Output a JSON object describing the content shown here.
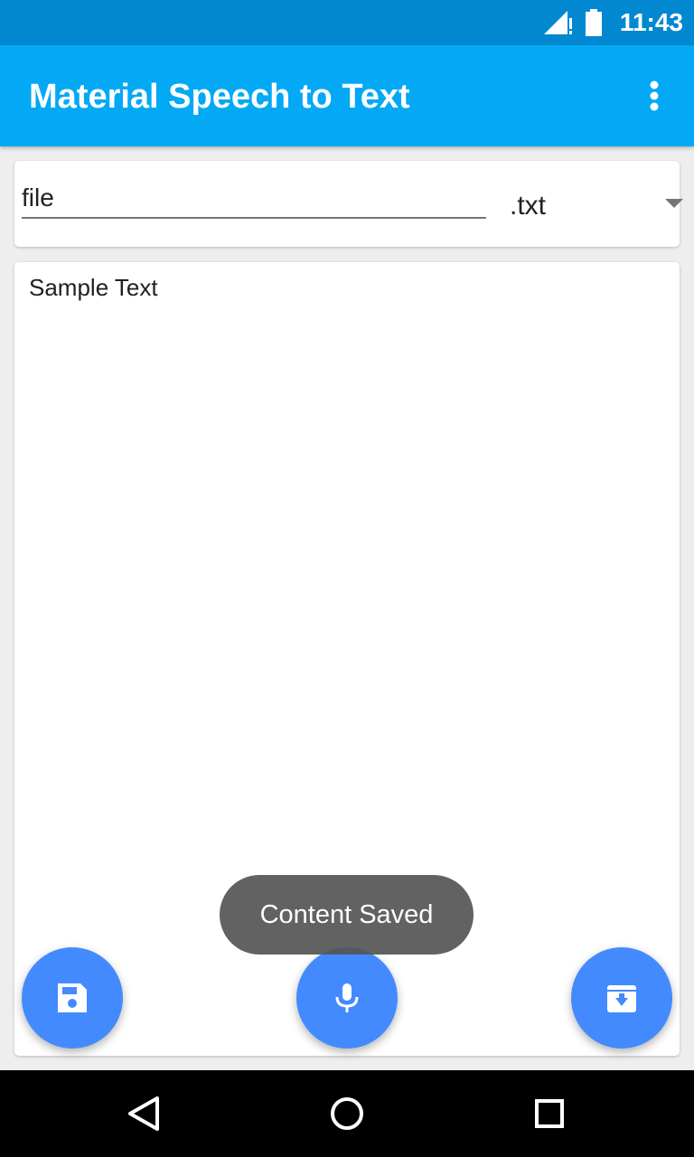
{
  "status_bar": {
    "time": "11:43",
    "icons": [
      "signal-icon",
      "battery-icon"
    ]
  },
  "app_bar": {
    "title": "Material Speech to Text",
    "menu_icon": "more-vert-icon"
  },
  "file_card": {
    "filename_value": "file",
    "extension_selected": ".txt"
  },
  "text_card": {
    "content": "Sample Text"
  },
  "toast": {
    "message": "Content Saved"
  },
  "fabs": [
    {
      "name": "save",
      "icon": "save-icon"
    },
    {
      "name": "mic",
      "icon": "microphone-icon"
    },
    {
      "name": "archive",
      "icon": "archive-icon"
    }
  ],
  "nav_bar": {
    "buttons": [
      "back-icon",
      "home-icon",
      "recents-icon"
    ]
  },
  "colors": {
    "status_bar": "#0288d1",
    "app_bar": "#03a9f4",
    "fab": "#448aff",
    "background": "#eeeeee",
    "toast": "#555555"
  }
}
